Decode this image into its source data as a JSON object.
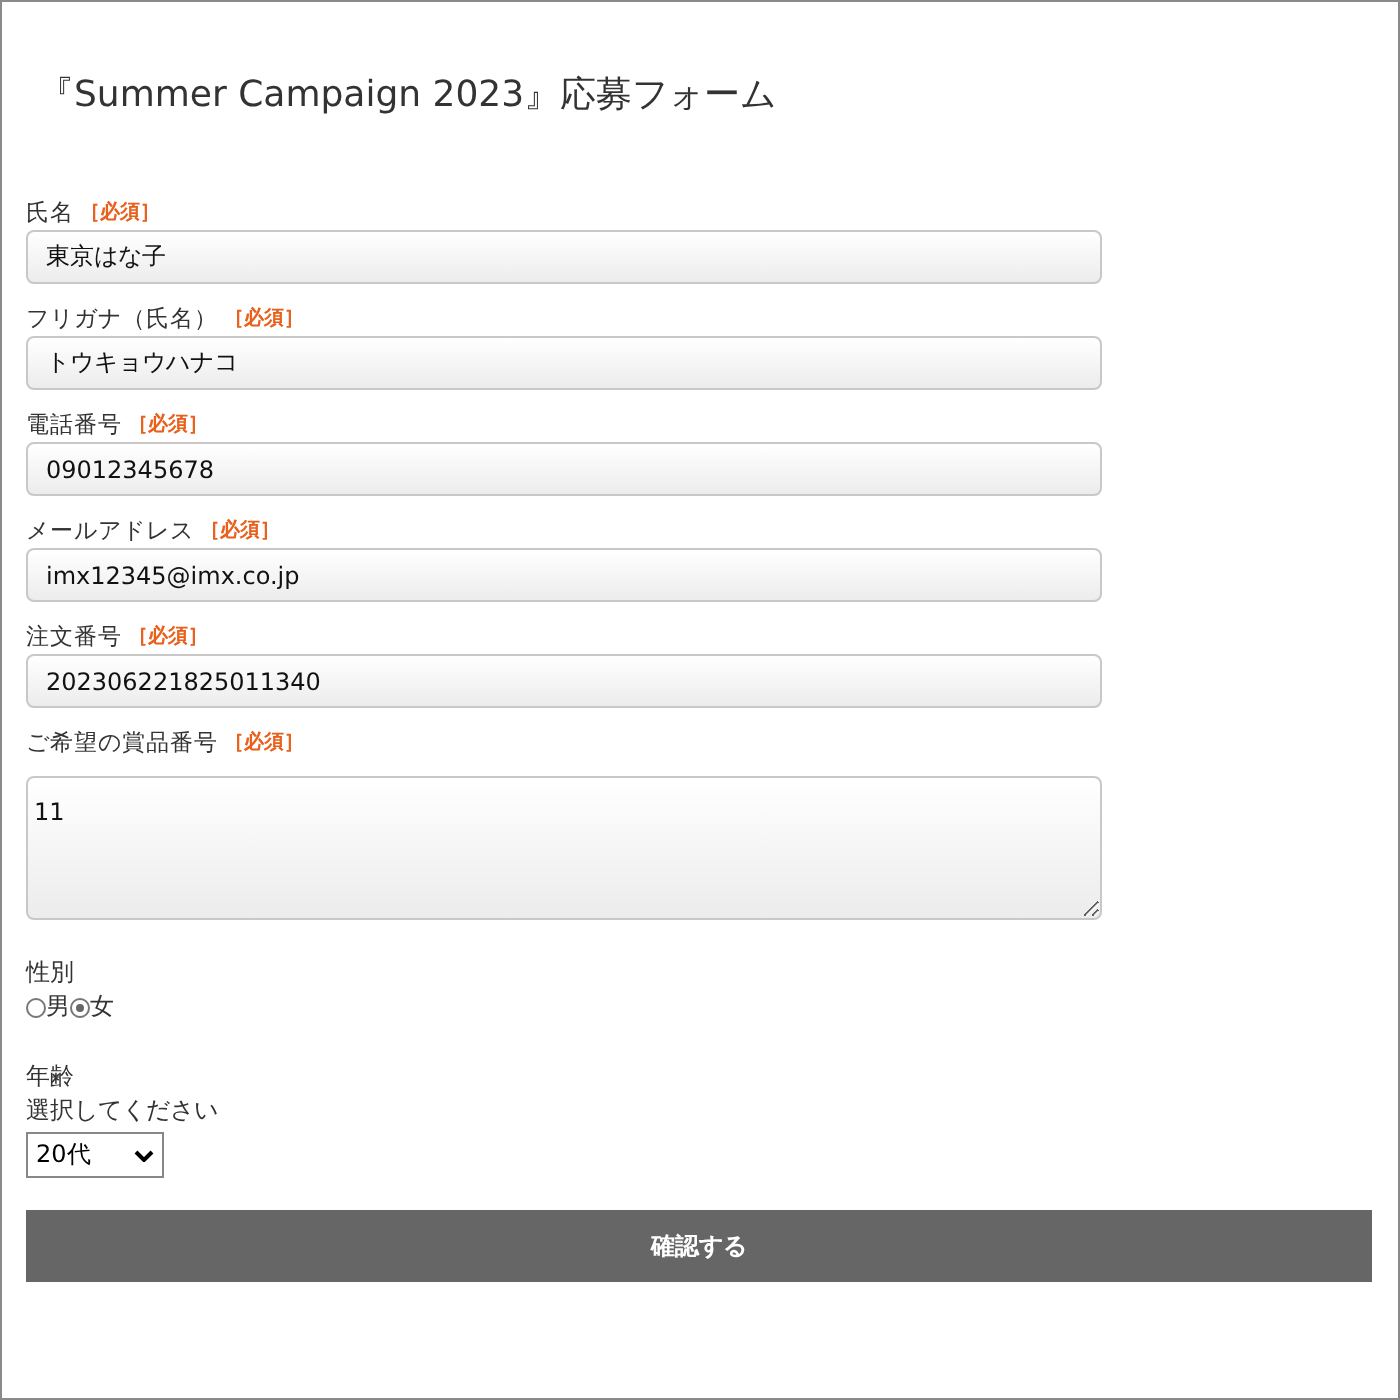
{
  "title": "『Summer Campaign 2023』応募フォーム",
  "fields": [
    {
      "kind": "text",
      "label": "氏名",
      "required_mark": "［必須］",
      "value": "東京はな子"
    },
    {
      "kind": "text",
      "label": "フリガナ（氏名）",
      "required_mark": "［必須］",
      "value": "トウキョウハナコ"
    },
    {
      "kind": "text",
      "label": "電話番号",
      "required_mark": "［必須］",
      "value": "09012345678"
    },
    {
      "kind": "text",
      "label": "メールアドレス",
      "required_mark": "［必須］",
      "value": "imx12345@imx.co.jp"
    },
    {
      "kind": "text",
      "label": "注文番号",
      "required_mark": "［必須］",
      "value": "202306221825011340"
    },
    {
      "kind": "textarea",
      "label": "ご希望の賞品番号",
      "required_mark": "［必須］",
      "value": "11"
    }
  ],
  "gender": {
    "label": "性別",
    "options": [
      {
        "label": "男",
        "selected": false
      },
      {
        "label": "女",
        "selected": true
      }
    ]
  },
  "age": {
    "label": "年齢",
    "hint": "選択してください",
    "value": "20代"
  },
  "submit": "確認する"
}
